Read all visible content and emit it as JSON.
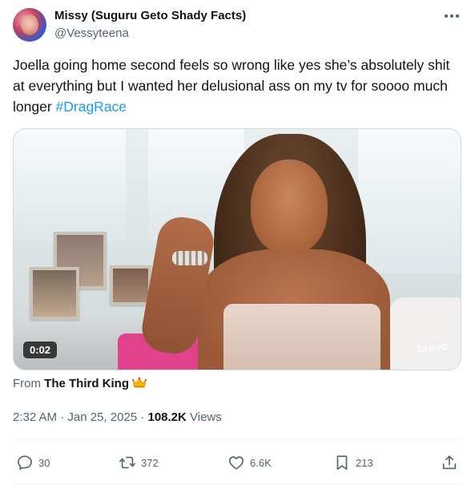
{
  "author": {
    "display_name": "Missy (Suguru Geto Shady Facts)",
    "handle": "@Vessyteena"
  },
  "tweet": {
    "text": "Joella going home second feels so wrong like yes she’s absolutely shit at everything but I wanted her delusional ass on my tv for soooo much longer ",
    "hashtag": "#DragRace"
  },
  "media": {
    "duration": "0:02",
    "watermark": "bravo"
  },
  "attribution": {
    "prefix": "From ",
    "source": "The Third King",
    "source_emoji": "crown-icon"
  },
  "meta": {
    "time": "2:32 AM",
    "separator1": " · ",
    "date": "Jan 25, 2025",
    "separator2": " · ",
    "views_count": "108.2K",
    "views_label": " Views"
  },
  "actions": {
    "replies": "30",
    "retweets": "372",
    "likes": "6.6K",
    "bookmarks": "213"
  },
  "colors": {
    "link": "#1d9bf0",
    "secondary_text": "#536471",
    "primary_text": "#0f1419"
  }
}
